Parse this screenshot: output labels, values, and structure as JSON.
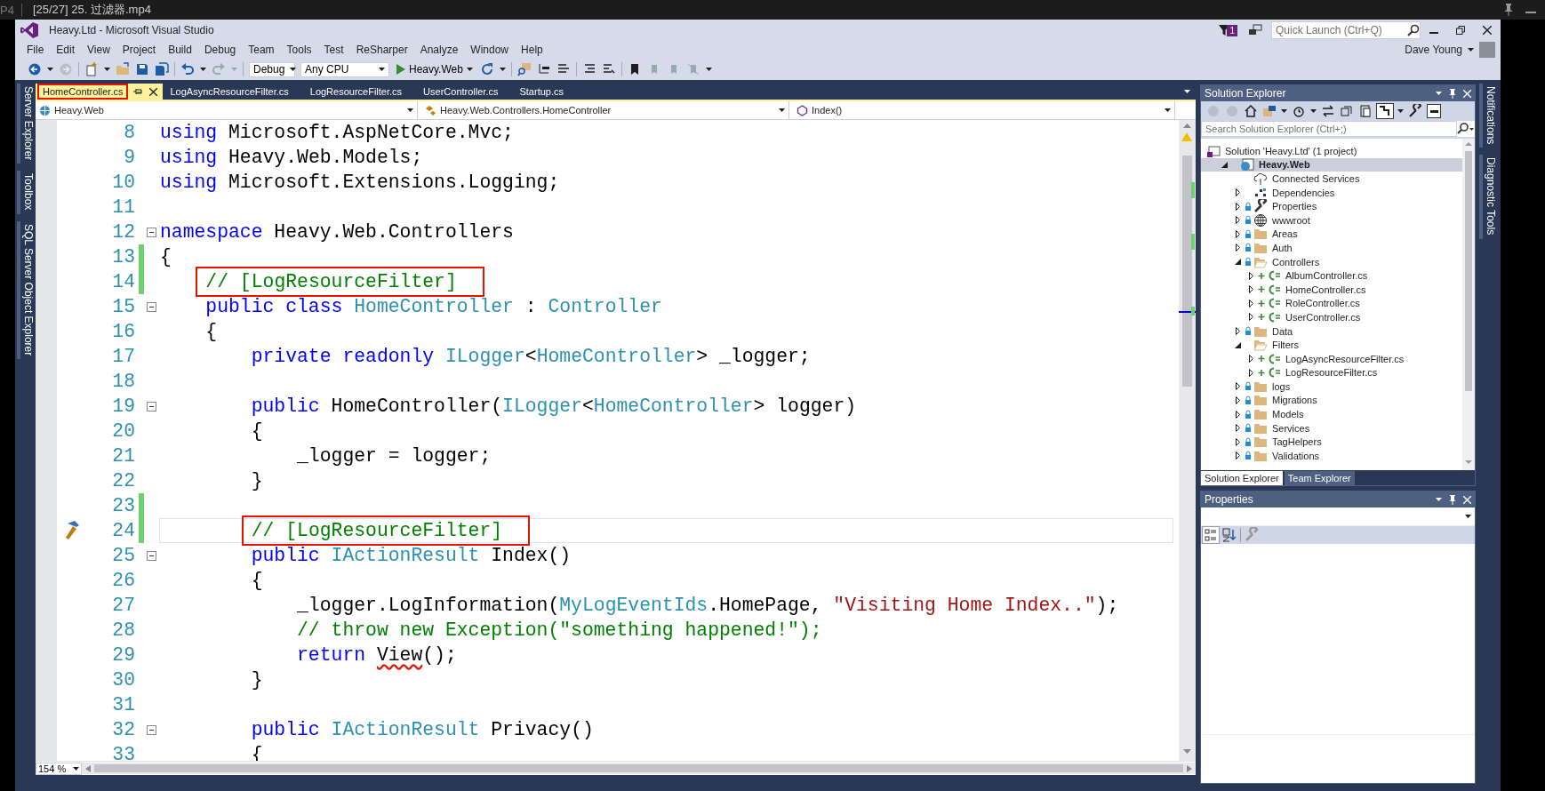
{
  "player": {
    "format": "P4",
    "title": "[25/27] 25. 过滤器.mp4"
  },
  "window": {
    "title": "Heavy.Ltd - Microsoft Visual Studio",
    "notification_count": "1",
    "quick_launch": {
      "placeholder": "Quick Launch (Ctrl+Q)"
    },
    "user": "Dave Young"
  },
  "menu": [
    "File",
    "Edit",
    "View",
    "Project",
    "Build",
    "Debug",
    "Team",
    "Tools",
    "Test",
    "ReSharper",
    "Analyze",
    "Window",
    "Help"
  ],
  "toolbar": {
    "configuration": "Debug",
    "platform": "Any CPU",
    "start": "Heavy.Web"
  },
  "left_strip": [
    "Server Explorer",
    "Toolbox",
    "SQL Server Object Explorer"
  ],
  "right_strip": [
    "Notifications",
    "Diagnostic Tools"
  ],
  "editor": {
    "tabs": [
      {
        "label": "HomeController.cs",
        "selected": true,
        "boxed": true
      },
      {
        "label": "LogAsyncResourceFilter.cs",
        "selected": false,
        "boxed": false
      },
      {
        "label": "LogResourceFilter.cs",
        "selected": false,
        "boxed": false
      },
      {
        "label": "UserController.cs",
        "selected": false,
        "boxed": false
      },
      {
        "label": "Startup.cs",
        "selected": false,
        "boxed": false
      }
    ],
    "nav": {
      "project": "Heavy.Web",
      "type": "Heavy.Web.Controllers.HomeController",
      "member": "Index()"
    },
    "lines": [
      {
        "number": "8",
        "changed": false,
        "fold": false,
        "current": false,
        "boxed": false,
        "quick_action": false,
        "tokens": [
          {
            "text": "using",
            "kind": "keyword"
          },
          {
            "text": " Microsoft.AspNetCore.Mvc;",
            "kind": "plain"
          }
        ]
      },
      {
        "number": "9",
        "changed": false,
        "fold": false,
        "current": false,
        "boxed": false,
        "quick_action": false,
        "tokens": [
          {
            "text": "using",
            "kind": "keyword"
          },
          {
            "text": " Heavy.Web.Models;",
            "kind": "plain"
          }
        ]
      },
      {
        "number": "10",
        "changed": false,
        "fold": false,
        "current": false,
        "boxed": false,
        "quick_action": false,
        "tokens": [
          {
            "text": "using",
            "kind": "keyword"
          },
          {
            "text": " Microsoft.Extensions.Logging;",
            "kind": "plain"
          }
        ]
      },
      {
        "number": "11",
        "changed": false,
        "fold": false,
        "current": false,
        "boxed": false,
        "quick_action": false
      },
      {
        "number": "12",
        "changed": false,
        "fold": true,
        "current": false,
        "boxed": false,
        "quick_action": false,
        "tokens": [
          {
            "text": "namespace",
            "kind": "keyword"
          },
          {
            "text": " Heavy.Web.Controllers",
            "kind": "plain"
          }
        ]
      },
      {
        "number": "13",
        "changed": true,
        "fold": false,
        "current": false,
        "boxed": false,
        "quick_action": false,
        "tokens": [
          {
            "text": "{",
            "kind": "plain"
          }
        ]
      },
      {
        "number": "14",
        "changed": true,
        "fold": false,
        "current": false,
        "boxed": true,
        "quick_action": false,
        "tokens": [
          {
            "text": "    // [LogResourceFilter]",
            "kind": "comment"
          }
        ]
      },
      {
        "number": "15",
        "changed": false,
        "fold": true,
        "current": false,
        "boxed": false,
        "quick_action": false,
        "tokens": [
          {
            "text": "    public class",
            "kind": "keyword"
          },
          {
            "text": " HomeController",
            "kind": "type"
          },
          {
            "text": " : ",
            "kind": "plain"
          },
          {
            "text": "Controller",
            "kind": "type"
          }
        ]
      },
      {
        "number": "16",
        "changed": false,
        "fold": false,
        "current": false,
        "boxed": false,
        "quick_action": false,
        "tokens": [
          {
            "text": "    {",
            "kind": "plain"
          }
        ]
      },
      {
        "number": "17",
        "changed": false,
        "fold": false,
        "current": false,
        "boxed": false,
        "quick_action": false,
        "tokens": [
          {
            "text": "        private readonly",
            "kind": "keyword"
          },
          {
            "text": " ILogger",
            "kind": "type"
          },
          {
            "text": "<",
            "kind": "plain"
          },
          {
            "text": "HomeController",
            "kind": "type"
          },
          {
            "text": "> _logger;",
            "kind": "plain"
          }
        ]
      },
      {
        "number": "18",
        "changed": false,
        "fold": false,
        "current": false,
        "boxed": false,
        "quick_action": false
      },
      {
        "number": "19",
        "changed": false,
        "fold": true,
        "current": false,
        "boxed": false,
        "quick_action": false,
        "tokens": [
          {
            "text": "        public",
            "kind": "keyword"
          },
          {
            "text": " HomeController(",
            "kind": "plain"
          },
          {
            "text": "ILogger",
            "kind": "type"
          },
          {
            "text": "<",
            "kind": "plain"
          },
          {
            "text": "HomeController",
            "kind": "type"
          },
          {
            "text": "> logger)",
            "kind": "plain"
          }
        ]
      },
      {
        "number": "20",
        "changed": false,
        "fold": false,
        "current": false,
        "boxed": false,
        "quick_action": false,
        "tokens": [
          {
            "text": "        {",
            "kind": "plain"
          }
        ]
      },
      {
        "number": "21",
        "changed": false,
        "fold": false,
        "current": false,
        "boxed": false,
        "quick_action": false,
        "tokens": [
          {
            "text": "            _logger = logger;",
            "kind": "plain"
          }
        ]
      },
      {
        "number": "22",
        "changed": false,
        "fold": false,
        "current": false,
        "boxed": false,
        "quick_action": false,
        "tokens": [
          {
            "text": "        }",
            "kind": "plain"
          }
        ]
      },
      {
        "number": "23",
        "changed": true,
        "fold": false,
        "current": false,
        "boxed": false,
        "quick_action": false
      },
      {
        "number": "24",
        "changed": true,
        "fold": false,
        "current": true,
        "boxed": true,
        "quick_action": true,
        "tokens": [
          {
            "text": "        // [LogResourceFilter]",
            "kind": "comment"
          }
        ]
      },
      {
        "number": "25",
        "changed": false,
        "fold": true,
        "current": false,
        "boxed": false,
        "quick_action": false,
        "tokens": [
          {
            "text": "        public",
            "kind": "keyword"
          },
          {
            "text": " IActionResult",
            "kind": "type"
          },
          {
            "text": " Index()",
            "kind": "plain"
          }
        ]
      },
      {
        "number": "26",
        "changed": false,
        "fold": false,
        "current": false,
        "boxed": false,
        "quick_action": false,
        "tokens": [
          {
            "text": "        {",
            "kind": "plain"
          }
        ]
      },
      {
        "number": "27",
        "changed": false,
        "fold": false,
        "current": false,
        "boxed": false,
        "quick_action": false,
        "tokens": [
          {
            "text": "            _logger.LogInformation(",
            "kind": "plain"
          },
          {
            "text": "MyLogEventIds",
            "kind": "type"
          },
          {
            "text": ".HomePage, ",
            "kind": "plain"
          },
          {
            "text": "\"Visiting Home Index..\"",
            "kind": "string"
          },
          {
            "text": ");",
            "kind": "plain"
          }
        ]
      },
      {
        "number": "28",
        "changed": false,
        "fold": false,
        "current": false,
        "boxed": false,
        "quick_action": false,
        "tokens": [
          {
            "text": "            // throw new Exception(\"something happened!\");",
            "kind": "comment"
          }
        ]
      },
      {
        "number": "29",
        "changed": false,
        "fold": false,
        "current": false,
        "boxed": false,
        "quick_action": false,
        "tokens": [
          {
            "text": "            return ",
            "kind": "keyword"
          },
          {
            "text": "View",
            "kind": "error"
          },
          {
            "text": "();",
            "kind": "plain"
          }
        ]
      },
      {
        "number": "30",
        "changed": false,
        "fold": false,
        "current": false,
        "boxed": false,
        "quick_action": false,
        "tokens": [
          {
            "text": "        }",
            "kind": "plain"
          }
        ]
      },
      {
        "number": "31",
        "changed": false,
        "fold": false,
        "current": false,
        "boxed": false,
        "quick_action": false
      },
      {
        "number": "32",
        "changed": false,
        "fold": true,
        "current": false,
        "boxed": false,
        "quick_action": false,
        "tokens": [
          {
            "text": "        public",
            "kind": "keyword"
          },
          {
            "text": " IActionResult",
            "kind": "type"
          },
          {
            "text": " Privacy()",
            "kind": "plain"
          }
        ]
      },
      {
        "number": "33",
        "changed": false,
        "fold": false,
        "current": false,
        "boxed": false,
        "quick_action": false,
        "tokens": [
          {
            "text": "        {",
            "kind": "plain"
          }
        ]
      }
    ],
    "zoom": "154 %"
  },
  "solution_explorer": {
    "title": "Solution Explorer",
    "search": {
      "placeholder": "Search Solution Explorer (Ctrl+;)"
    },
    "tree": [
      {
        "label": "Solution 'Heavy.Ltd' (1 project)",
        "kind": "solution",
        "selected": false,
        "children": [
          {
            "label": "Heavy.Web",
            "kind": "project",
            "expanded": true,
            "selected": true,
            "locked": false,
            "added": false,
            "children": [
              {
                "label": "Connected Services",
                "kind": "connected",
                "selected": false,
                "locked": false,
                "added": false
              },
              {
                "label": "Dependencies",
                "kind": "dependencies",
                "expanded": false,
                "selected": false,
                "locked": false,
                "added": false
              },
              {
                "label": "Properties",
                "kind": "properties",
                "expanded": false,
                "selected": false,
                "locked": true,
                "added": false
              },
              {
                "label": "wwwroot",
                "kind": "web",
                "expanded": false,
                "selected": false,
                "locked": true,
                "added": false
              },
              {
                "label": "Areas",
                "kind": "folder",
                "expanded": false,
                "selected": false,
                "locked": true,
                "added": false
              },
              {
                "label": "Auth",
                "kind": "folder",
                "expanded": false,
                "selected": false,
                "locked": true,
                "added": false
              },
              {
                "label": "Controllers",
                "kind": "folder",
                "expanded": true,
                "selected": false,
                "locked": true,
                "added": false,
                "children": [
                  {
                    "label": "AlbumController.cs",
                    "kind": "csfile",
                    "expanded": false,
                    "selected": false,
                    "locked": false,
                    "added": true
                  },
                  {
                    "label": "HomeController.cs",
                    "kind": "csfile",
                    "expanded": false,
                    "selected": false,
                    "locked": false,
                    "added": true
                  },
                  {
                    "label": "RoleController.cs",
                    "kind": "csfile",
                    "expanded": false,
                    "selected": false,
                    "locked": false,
                    "added": true
                  },
                  {
                    "label": "UserController.cs",
                    "kind": "csfile",
                    "expanded": false,
                    "selected": false,
                    "locked": false,
                    "added": true
                  }
                ]
              },
              {
                "label": "Data",
                "kind": "folder",
                "expanded": false,
                "selected": false,
                "locked": true,
                "added": false
              },
              {
                "label": "Filters",
                "kind": "folder",
                "expanded": true,
                "selected": false,
                "locked": false,
                "added": false,
                "children": [
                  {
                    "label": "LogAsyncResourceFilter.cs",
                    "kind": "csfile",
                    "expanded": false,
                    "selected": false,
                    "locked": false,
                    "added": true
                  },
                  {
                    "label": "LogResourceFilter.cs",
                    "kind": "csfile",
                    "expanded": false,
                    "selected": false,
                    "locked": false,
                    "added": true
                  }
                ]
              },
              {
                "label": "logs",
                "kind": "folder",
                "expanded": false,
                "selected": false,
                "locked": true,
                "added": false
              },
              {
                "label": "Migrations",
                "kind": "folder",
                "expanded": false,
                "selected": false,
                "locked": true,
                "added": false
              },
              {
                "label": "Models",
                "kind": "folder",
                "expanded": false,
                "selected": false,
                "locked": true,
                "added": false
              },
              {
                "label": "Services",
                "kind": "folder",
                "expanded": false,
                "selected": false,
                "locked": true,
                "added": false
              },
              {
                "label": "TagHelpers",
                "kind": "folder",
                "expanded": false,
                "selected": false,
                "locked": true,
                "added": false
              },
              {
                "label": "Validations",
                "kind": "folder",
                "expanded": false,
                "selected": false,
                "locked": true,
                "added": false
              }
            ]
          }
        ]
      }
    ],
    "tabs": [
      {
        "label": "Solution Explorer",
        "selected": true
      },
      {
        "label": "Team Explorer",
        "selected": false
      }
    ]
  },
  "properties": {
    "title": "Properties"
  }
}
